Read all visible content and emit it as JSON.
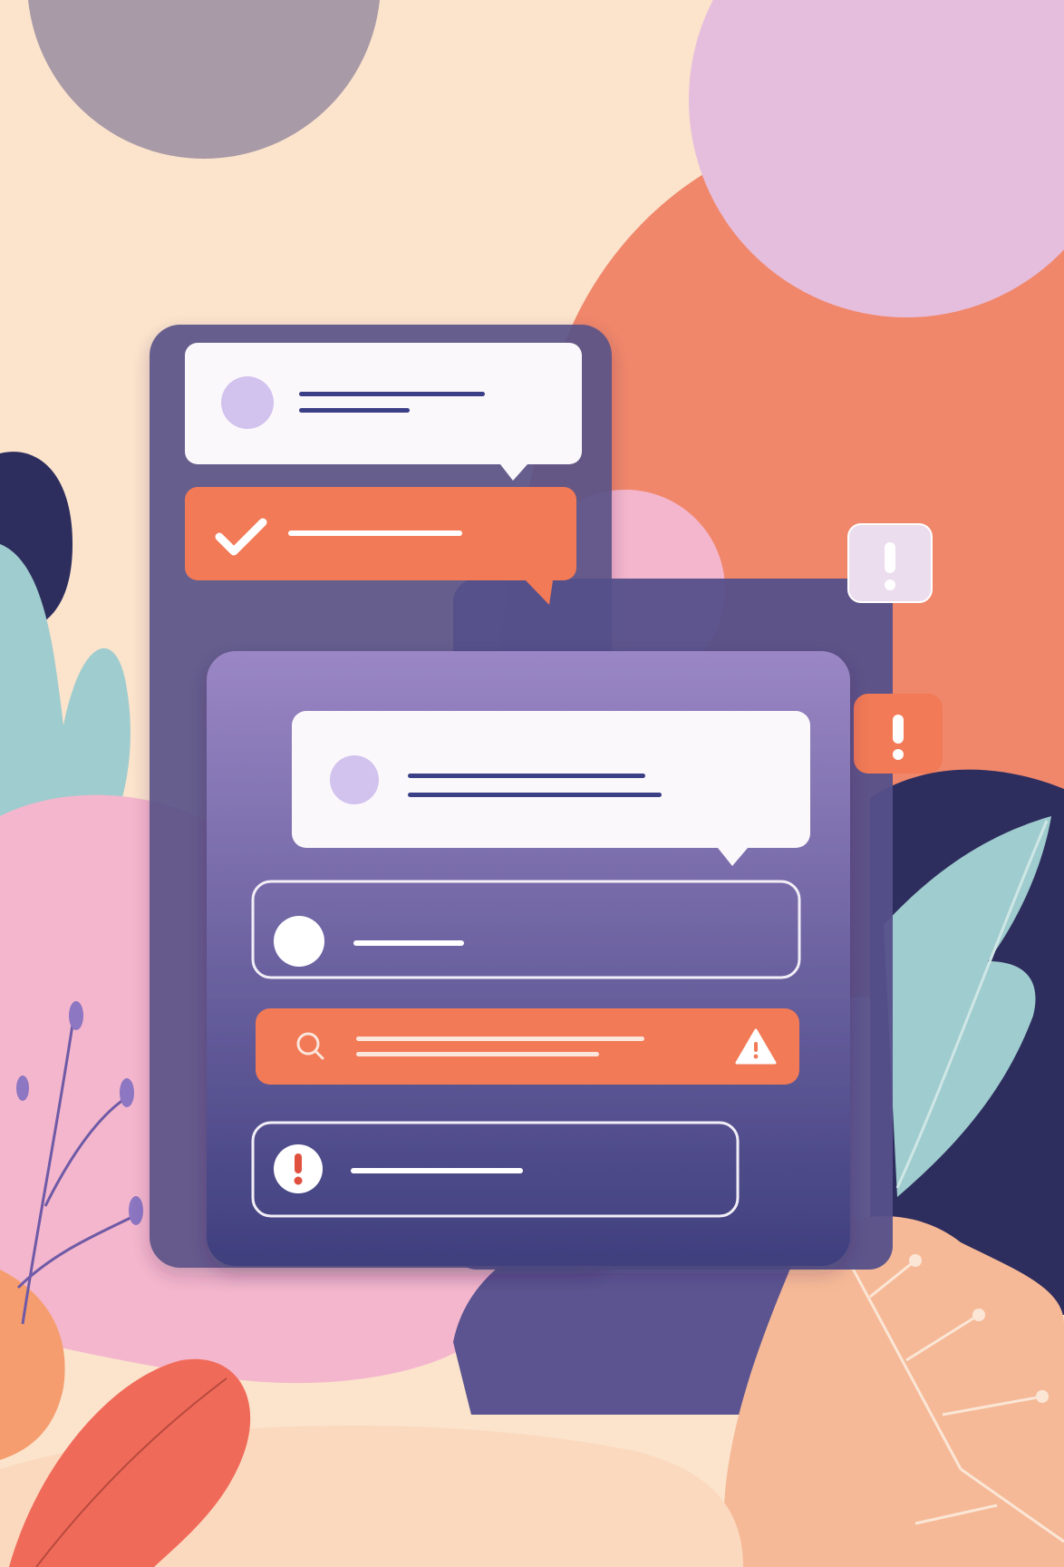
{
  "colors": {
    "background": "#FBE3CC",
    "gray_blob": "#A89AA6",
    "lilac_blob": "#E6BEDD",
    "coral_blob": "#F0876B",
    "navy": "#2E2E5E",
    "teal_leaf": "#9FCCCE",
    "pink_blob": "#F4B6CC",
    "peach_leaf": "#F6B997",
    "red_leaf": "#F06A5A",
    "panel_back": "#5A5288",
    "panel_front_top": "#9A86C4",
    "panel_front_bottom": "#3F3F7E",
    "card_white": "#FBF8FB",
    "accent_orange": "#F27A56",
    "avatar_lilac": "#D2C2EE",
    "text_line_navy": "#3A3F86",
    "alert_lilac_bg": "#ECDDEE"
  },
  "icons": {
    "check": "check-icon",
    "search": "search-icon",
    "warning": "warning-triangle-icon",
    "exclamation": "exclamation-icon",
    "avatar": "avatar-icon"
  }
}
